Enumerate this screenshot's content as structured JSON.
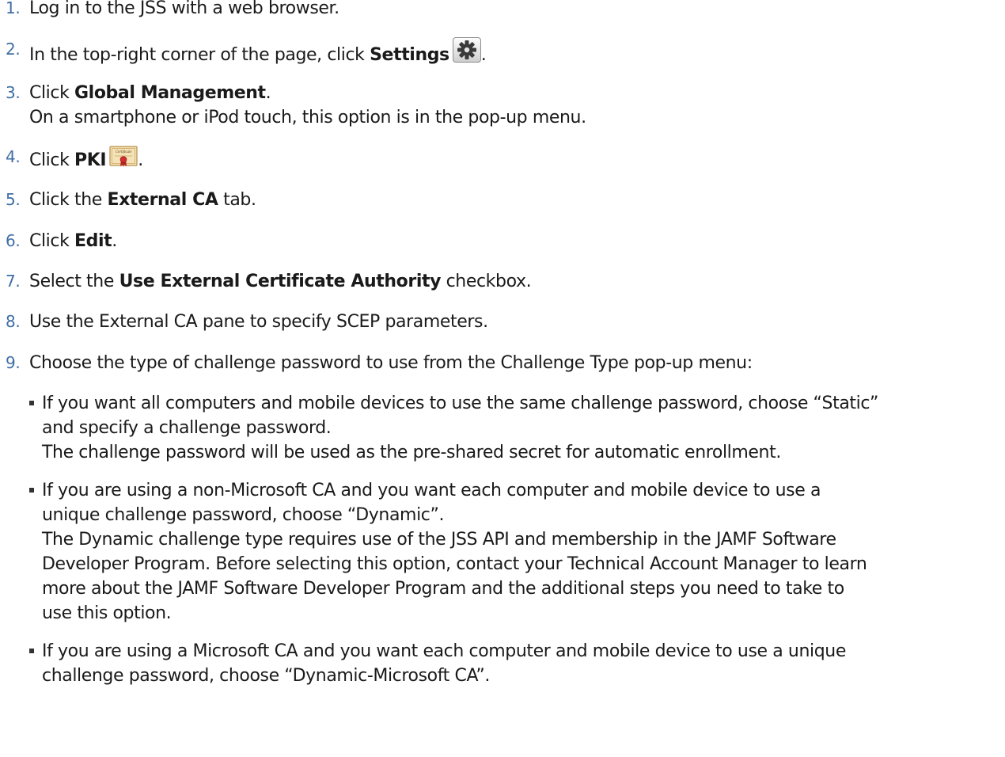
{
  "steps": [
    {
      "num": "1.",
      "text": "Log in to the JSS with a web browser."
    },
    {
      "num": "2.",
      "before": "In the top-right corner of the page, click ",
      "bold": "Settings",
      "after": ".",
      "icon": "gear-icon"
    },
    {
      "num": "3.",
      "before": "Click ",
      "bold": "Global Management",
      "after": ".",
      "note": "On a smartphone or iPod touch, this option is in the pop-up menu."
    },
    {
      "num": "4.",
      "before": "Click ",
      "bold": "PKI",
      "after": ".",
      "icon": "certificate-icon",
      "icon_text": "Certificate"
    },
    {
      "num": "5.",
      "before": "Click the ",
      "bold": "External CA",
      "after": " tab."
    },
    {
      "num": "6.",
      "before": "Click ",
      "bold": "Edit",
      "after": "."
    },
    {
      "num": "7.",
      "before": "Select the ",
      "bold": "Use External Certificate Authority",
      "after": " checkbox."
    },
    {
      "num": "8.",
      "text": "Use the External CA pane to specify SCEP parameters."
    },
    {
      "num": "9.",
      "text": "Choose the type of challenge password to use from the Challenge Type pop-up menu:"
    }
  ],
  "bullets": [
    {
      "lines": [
        "If you want all computers and mobile devices to use the same challenge password, choose “Static”",
        "and specify a challenge password.",
        "The challenge password will be used as the pre-shared secret for automatic enrollment."
      ]
    },
    {
      "lines": [
        "If you are using a non-Microsoft CA and you want each computer and mobile device to use a",
        "unique challenge password, choose “Dynamic”.",
        "The Dynamic challenge type requires use of the JSS API and membership in the JAMF Software",
        "Developer Program. Before selecting this option, contact your Technical Account Manager to learn",
        "more about the JAMF Software Developer Program and the additional steps you need to take to",
        "use this option."
      ]
    },
    {
      "lines": [
        "If you are using a Microsoft CA and you want each computer and mobile device to use a unique",
        "challenge password, choose “Dynamic-Microsoft CA”."
      ]
    }
  ]
}
